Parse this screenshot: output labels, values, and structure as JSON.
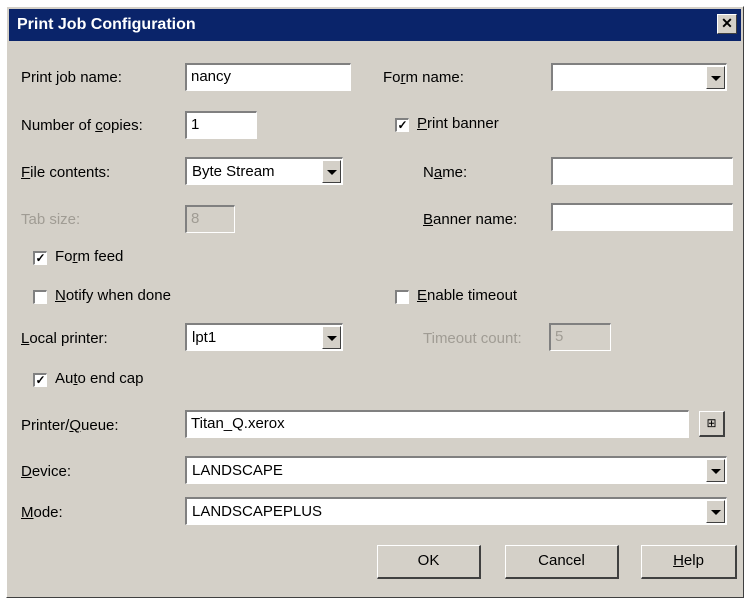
{
  "window": {
    "title": "Print Job Configuration",
    "close_glyph": "✕"
  },
  "labels": {
    "print_job_name": "Print job name:",
    "number_of_copies": [
      "Number of ",
      "c",
      "opies:"
    ],
    "file_contents": [
      "",
      "F",
      "ile contents:"
    ],
    "tab_size": "Tab size:",
    "form_feed": [
      "Fo",
      "r",
      "m feed"
    ],
    "notify_when_done": [
      "",
      "N",
      "otify when done"
    ],
    "local_printer": [
      "",
      "L",
      "ocal printer:"
    ],
    "auto_end_cap": [
      "Au",
      "t",
      "o end cap"
    ],
    "printer_queue": [
      "Printer/",
      "Q",
      "ueue:"
    ],
    "device": [
      "",
      "D",
      "evice:"
    ],
    "mode": [
      "",
      "M",
      "ode:"
    ],
    "form_name": [
      "Fo",
      "r",
      "m name:"
    ],
    "print_banner": [
      "",
      "P",
      "rint banner"
    ],
    "name": [
      "N",
      "a",
      "me:"
    ],
    "banner_name": [
      "",
      "B",
      "anner name:"
    ],
    "enable_timeout": [
      "",
      "E",
      "nable timeout"
    ],
    "timeout_count": "Timeout count:"
  },
  "values": {
    "print_job_name": "nancy",
    "number_of_copies": "1",
    "file_contents": "Byte Stream",
    "tab_size": "8",
    "local_printer": "lpt1",
    "printer_queue": "Titan_Q.xerox",
    "device": "LANDSCAPE",
    "mode": "LANDSCAPEPLUS",
    "form_name": "",
    "name": "",
    "banner_name": "",
    "timeout_count": "5"
  },
  "checkboxes": {
    "form_feed": true,
    "notify_when_done": false,
    "auto_end_cap": true,
    "print_banner": true,
    "enable_timeout": false
  },
  "check_glyph": "✓",
  "buttons": {
    "ok": "OK",
    "cancel": "Cancel",
    "help": [
      "",
      "H",
      "elp"
    ],
    "browse": "⊞"
  }
}
